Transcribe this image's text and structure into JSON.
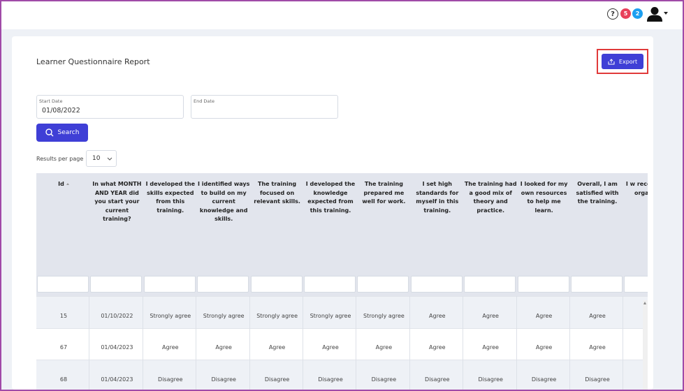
{
  "header": {
    "help_icon": "?",
    "notifications_count": "5",
    "messages_count": "2",
    "colors": {
      "badge_red": "#e8405a",
      "badge_blue": "#1d9ff0",
      "accent": "#3f3fd6",
      "highlight": "#e03a3a"
    }
  },
  "page": {
    "title": "Learner Questionnaire Report",
    "export_label": "Export"
  },
  "filters": {
    "start_label": "Start Date",
    "start_value": "01/08/2022",
    "end_label": "End Date",
    "end_value": "",
    "search_label": "Search"
  },
  "pagination": {
    "results_per_page_label": "Results per page",
    "results_per_page_value": "10"
  },
  "table": {
    "columns": [
      "Id",
      "In what MONTH AND YEAR did you start your current training?",
      "I developed the skills expected from this training.",
      "I identified ways to build on my current knowledge and skills.",
      "The training focused on relevant skills.",
      "I developed the knowledge expected from this training.",
      "The training prepared me well for work.",
      "I set high standards for myself in this training.",
      "The training had a good mix of theory and practice.",
      "I looked for my own resources to help me learn.",
      "Overall, I am satisfied with the training.",
      "I w recomm trai organi oth"
    ],
    "rows": [
      [
        "15",
        "01/10/2022",
        "Strongly agree",
        "Strongly agree",
        "Strongly agree",
        "Strongly agree",
        "Strongly agree",
        "Agree",
        "Agree",
        "Agree",
        "Agree",
        ""
      ],
      [
        "67",
        "01/04/2023",
        "Agree",
        "Agree",
        "Agree",
        "Agree",
        "Agree",
        "Agree",
        "Agree",
        "Agree",
        "Agree",
        ""
      ],
      [
        "68",
        "01/04/2023",
        "Disagree",
        "Disagree",
        "Disagree",
        "Disagree",
        "Disagree",
        "Disagree",
        "Disagree",
        "Disagree",
        "Disagree",
        ""
      ]
    ]
  }
}
